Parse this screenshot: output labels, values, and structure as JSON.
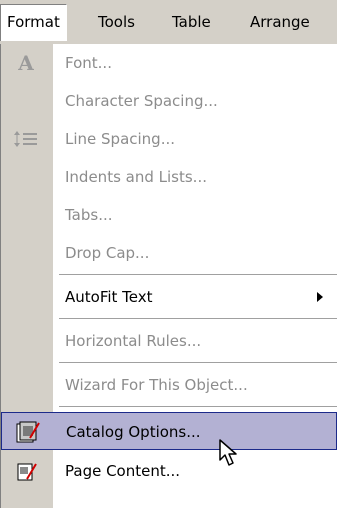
{
  "menubar": {
    "format": "Format",
    "tools": "Tools",
    "table": "Table",
    "arrange": "Arrange"
  },
  "menu": {
    "font": "Font...",
    "character_spacing": "Character Spacing...",
    "line_spacing": "Line Spacing...",
    "indents_and_lists": "Indents and Lists...",
    "tabs": "Tabs...",
    "drop_cap": "Drop Cap...",
    "autofit_text": "AutoFit Text",
    "horizontal_rules": "Horizontal Rules...",
    "wizard_for_this_object": "Wizard For This Object...",
    "catalog_options": "Catalog Options...",
    "page_content": "Page Content..."
  },
  "icons": {
    "font": "font-icon",
    "line_spacing": "line-spacing-icon",
    "catalog_options": "catalog-options-icon",
    "page_content": "page-content-icon"
  },
  "colors": {
    "menu_background": "#d4d0c8",
    "highlight": "#b3b1d3",
    "highlight_border": "#1c2a8a",
    "disabled_text": "#8c8c8c"
  }
}
